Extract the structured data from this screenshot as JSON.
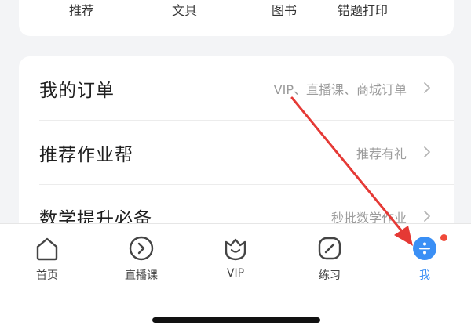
{
  "shop_categories": [
    "推荐",
    "文具",
    "图书",
    "错题打印"
  ],
  "menu": [
    {
      "title": "我的订单",
      "hint": "VIP、直播课、商城订单"
    },
    {
      "title": "推荐作业帮",
      "hint": "推荐有礼"
    },
    {
      "title": "数学提升必备",
      "hint": "秒批数学作业"
    }
  ],
  "tabs": [
    {
      "label": "首页",
      "icon": "home-icon"
    },
    {
      "label": "直播课",
      "icon": "play-circle-icon"
    },
    {
      "label": "VIP",
      "icon": "vip-crown-icon"
    },
    {
      "label": "练习",
      "icon": "pencil-icon"
    },
    {
      "label": "我",
      "icon": "profile-icon",
      "active": true
    }
  ],
  "colors": {
    "accent": "#3a8ff5",
    "annotation_arrow": "#e53935",
    "badge": "#f04a3a"
  }
}
